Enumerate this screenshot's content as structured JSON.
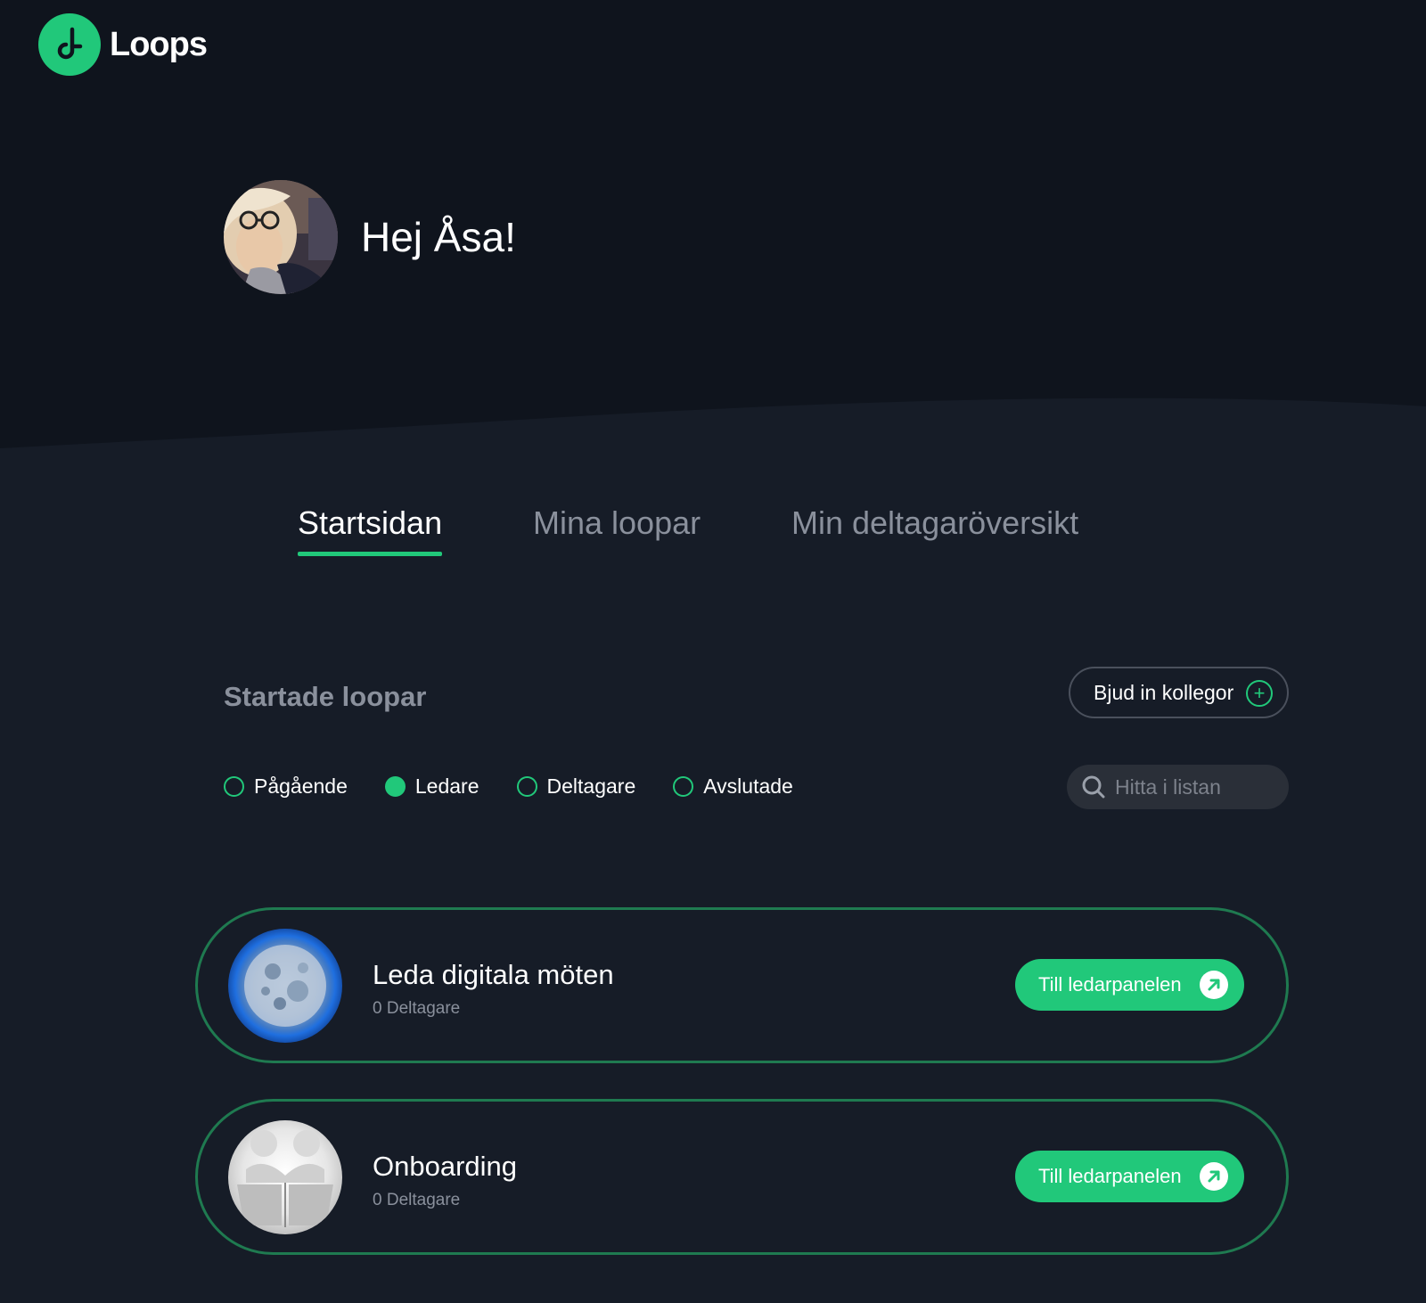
{
  "app": {
    "name": "Loops",
    "brand_color": "#21c87a"
  },
  "greeting": {
    "text": "Hej Åsa!"
  },
  "tabs": [
    {
      "label": "Startsidan",
      "active": true
    },
    {
      "label": "Mina loopar",
      "active": false
    },
    {
      "label": "Min deltagaröversikt",
      "active": false
    }
  ],
  "section": {
    "title": "Startade loopar"
  },
  "invite_button": {
    "label": "Bjud in kollegor",
    "icon": "plus-circle-icon"
  },
  "filters": [
    {
      "label": "Pågående",
      "checked": false
    },
    {
      "label": "Ledare",
      "checked": true
    },
    {
      "label": "Deltagare",
      "checked": false
    },
    {
      "label": "Avslutade",
      "checked": false
    }
  ],
  "search": {
    "placeholder": "Hitta i listan",
    "value": ""
  },
  "loops": [
    {
      "title": "Leda digitala möten",
      "participants": "0 Deltagare",
      "action_label": "Till ledarpanelen",
      "image": "moon"
    },
    {
      "title": "Onboarding",
      "participants": "0 Deltagare",
      "action_label": "Till ledarpanelen",
      "image": "handshake"
    }
  ]
}
